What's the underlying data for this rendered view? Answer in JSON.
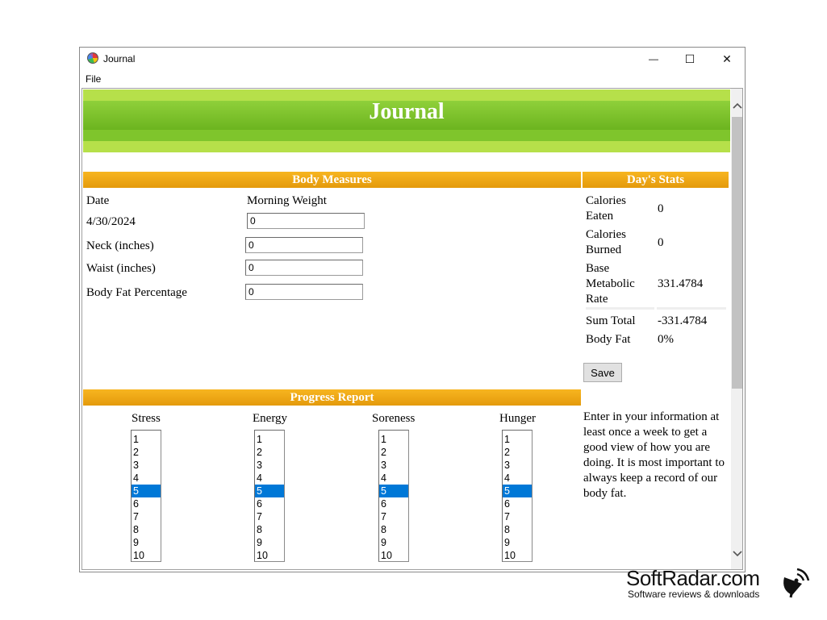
{
  "window": {
    "title": "Journal",
    "menu": [
      "File"
    ],
    "controls": {
      "minimize": "—",
      "maximize": "☐",
      "close": "✕"
    }
  },
  "banner": {
    "title": "Journal"
  },
  "body_measures": {
    "header": "Body Measures",
    "date_label": "Date",
    "date_value": "4/30/2024",
    "morning_weight_label": "Morning Weight",
    "morning_weight_value": "0",
    "neck_label": "Neck (inches)",
    "neck_value": "0",
    "waist_label": "Waist (inches)",
    "waist_value": "0",
    "body_fat_label": "Body Fat Percentage",
    "body_fat_value": "0"
  },
  "days_stats": {
    "header": "Day's Stats",
    "calories_eaten_label": "Calories Eaten",
    "calories_eaten_value": "0",
    "calories_burned_label": "Calories Burned",
    "calories_burned_value": "0",
    "bmr_label": "Base Metabolic Rate",
    "bmr_value": "331.4784",
    "sum_total_label": "Sum Total",
    "sum_total_value": "-331.4784",
    "body_fat_label": "Body Fat",
    "body_fat_value": "0%",
    "save_label": "Save",
    "note": "Enter in your information at least once a week to get a good view of how you are doing.  It is most important to always keep a record of our body fat."
  },
  "progress_report": {
    "header": "Progress Report",
    "stress_label": "Stress",
    "energy_label": "Energy",
    "soreness_label": "Soreness",
    "hunger_label": "Hunger",
    "options": [
      "1",
      "2",
      "3",
      "4",
      "5",
      "6",
      "7",
      "8",
      "9",
      "10"
    ],
    "selected": "5"
  },
  "watermark": {
    "name": "SoftRadar.com",
    "tagline": "Software reviews & downloads"
  },
  "colors": {
    "banner_green": "#7fc52c",
    "section_orange": "#f0a810",
    "selection_blue": "#0078d7"
  }
}
